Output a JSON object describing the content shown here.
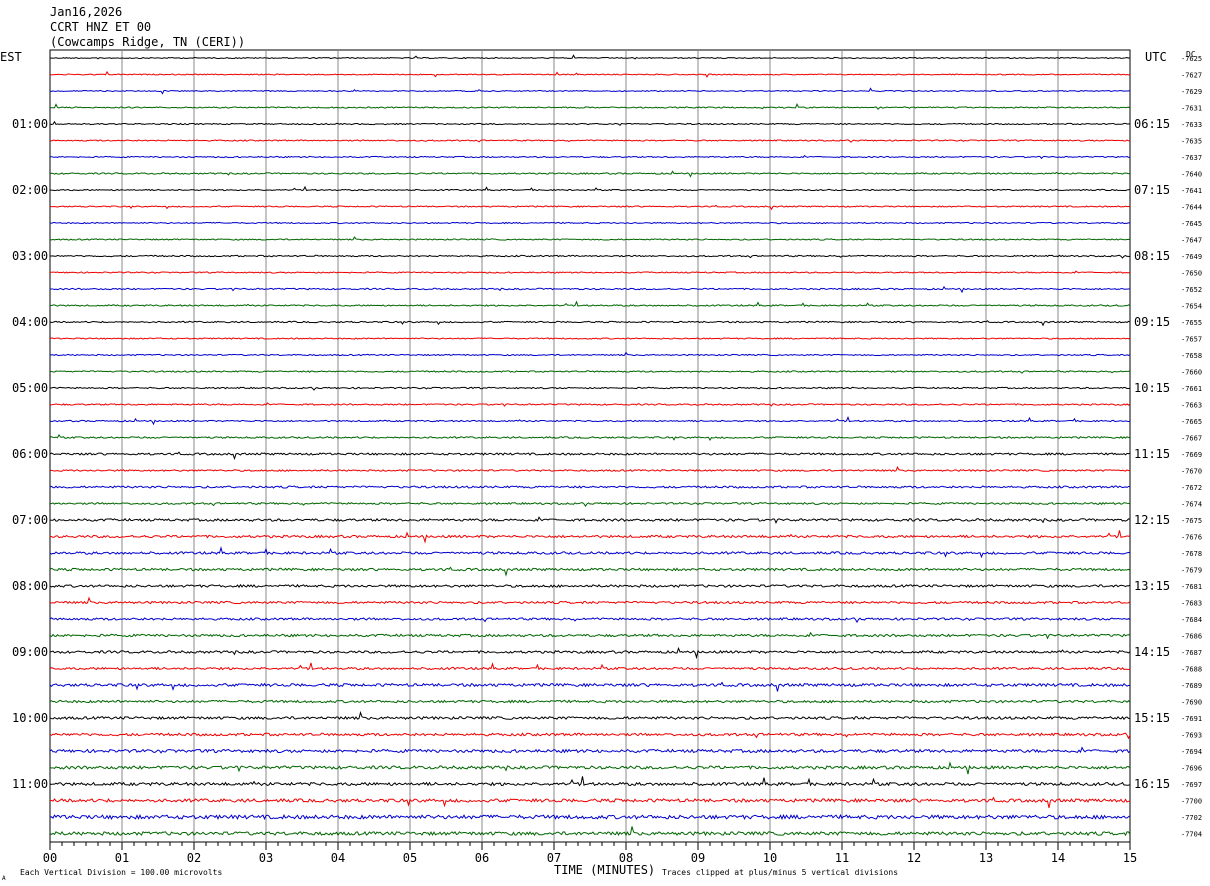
{
  "header": {
    "date": "Jan16,2026",
    "station": "CCRT HNZ ET 00",
    "location": "(Cowcamps Ridge, TN (CERI))"
  },
  "labels": {
    "left_zone": "EST",
    "right_zone": "UTC",
    "dc": "DC",
    "xlabel": "TIME (MINUTES)",
    "scale_note": "Each Vertical Division =  100.00 microvolts",
    "clip_note": "Traces clipped at plus/minus 5 vertical divisions",
    "corner_mark": "A"
  },
  "colors": {
    "background": "#ffffff",
    "grid": "#888888",
    "text": "#000000",
    "trace_cycle": [
      "#000000",
      "#ee0000",
      "#0000cc",
      "#006600"
    ]
  },
  "chart_data": {
    "type": "line",
    "x_ticks": [
      "00",
      "01",
      "02",
      "03",
      "04",
      "05",
      "06",
      "07",
      "08",
      "09",
      "10",
      "11",
      "12",
      "13",
      "14",
      "15"
    ],
    "xlim": [
      0,
      15
    ],
    "left_hour_labels": [
      "01:00",
      "02:00",
      "03:00",
      "04:00",
      "05:00",
      "06:00",
      "07:00",
      "08:00",
      "09:00",
      "10:00",
      "11:00"
    ],
    "right_hour_labels": [
      "06:15",
      "07:15",
      "08:15",
      "09:15",
      "10:15",
      "11:15",
      "12:15",
      "13:15",
      "14:15",
      "15:15",
      "16:15"
    ],
    "dc_values": [
      "-7625",
      "-7627",
      "-7629",
      "-7631",
      "-7633",
      "-7635",
      "-7637",
      "-7640",
      "-7641",
      "-7644",
      "-7645",
      "-7647",
      "-7649",
      "-7650",
      "-7652",
      "-7654",
      "-7655",
      "-7657",
      "-7658",
      "-7660",
      "-7661",
      "-7663",
      "-7665",
      "-7667",
      "-7669",
      "-7670",
      "-7672",
      "-7674",
      "-7675",
      "-7676",
      "-7678",
      "-7679",
      "-7681",
      "-7683",
      "-7684",
      "-7686",
      "-7687",
      "-7688",
      "-7689",
      "-7690",
      "-7691",
      "-7693",
      "-7694",
      "-7696",
      "-7697",
      "-7700",
      "-7702",
      "-7704"
    ],
    "trace_noise_levels": [
      0.5,
      0.5,
      0.5,
      0.6,
      0.6,
      0.6,
      0.6,
      0.7,
      0.6,
      0.6,
      0.6,
      0.6,
      0.7,
      0.6,
      0.7,
      0.7,
      0.7,
      0.6,
      0.6,
      0.7,
      0.7,
      0.7,
      0.7,
      0.8,
      1.0,
      0.8,
      1.0,
      0.9,
      1.2,
      1.2,
      1.2,
      1.2,
      1.2,
      1.1,
      1.1,
      1.2,
      1.2,
      1.1,
      1.4,
      1.2,
      1.3,
      1.3,
      1.5,
      1.5,
      1.5,
      1.6,
      1.9,
      1.7
    ]
  }
}
